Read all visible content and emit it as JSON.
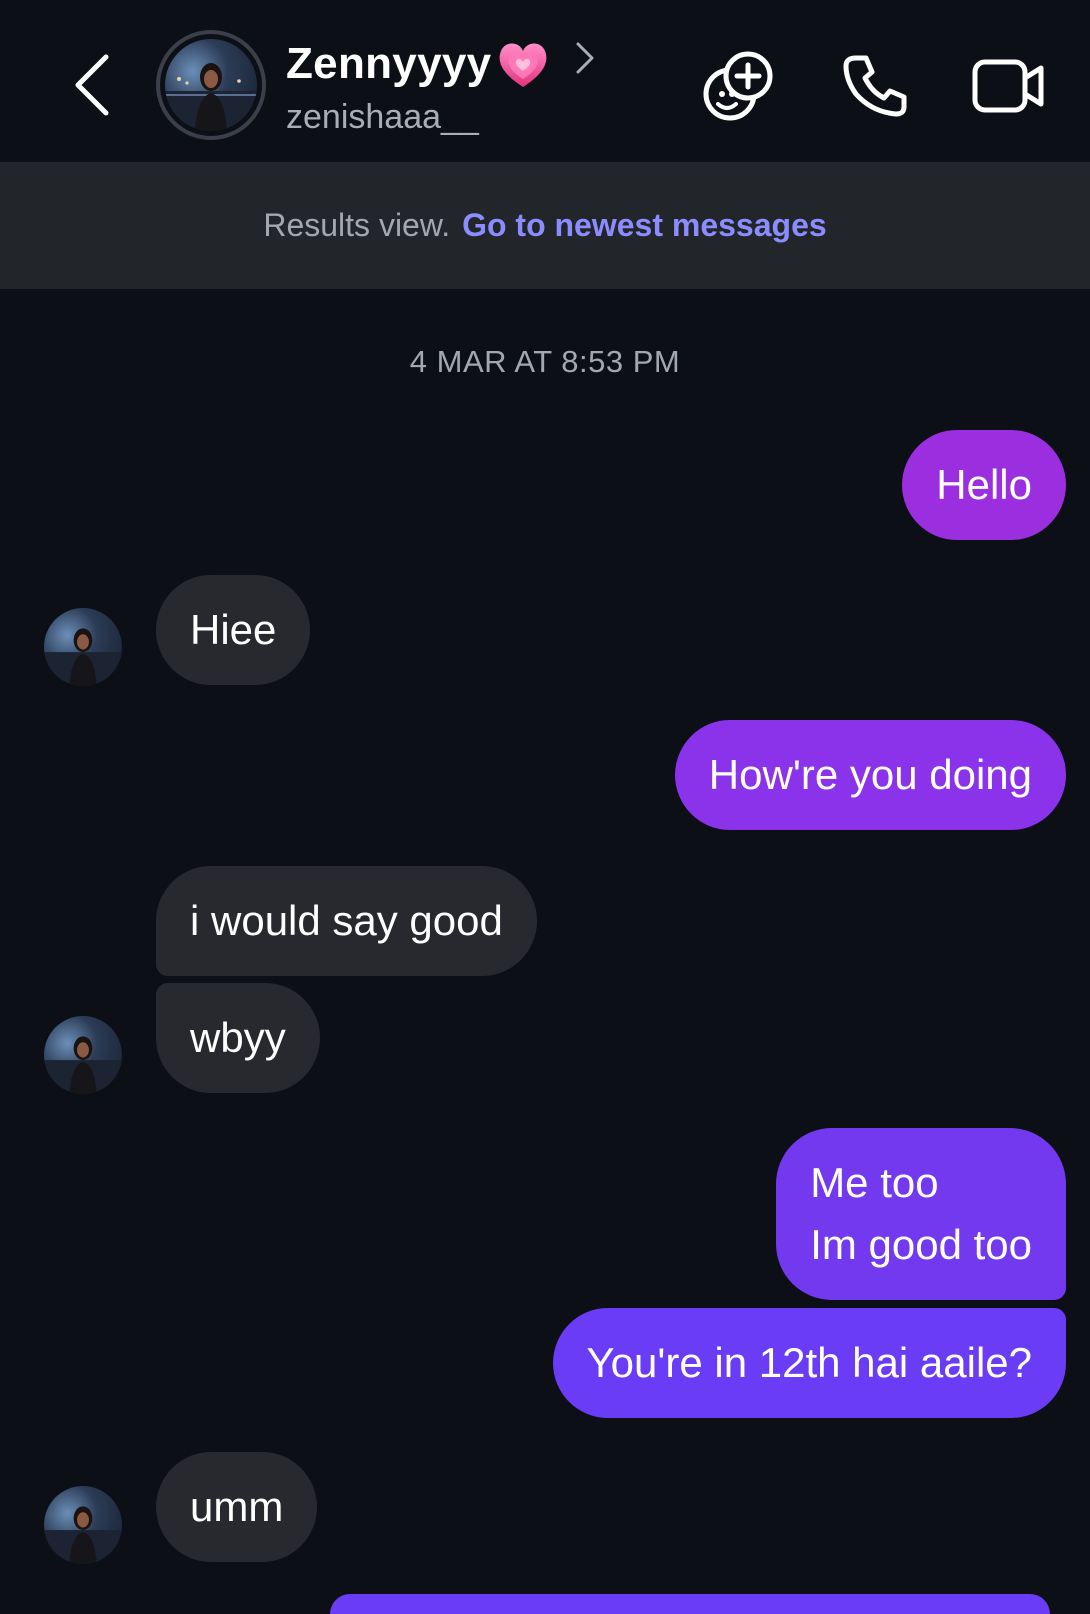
{
  "header": {
    "contact_name": "Zennyyyy",
    "contact_username": "zenishaaa__",
    "icons": {
      "back": "chevron-left-icon",
      "heart": "growing-heart-emoji",
      "open_profile": "chevron-right-icon",
      "stickers": "add-sticker-icon",
      "call": "phone-icon",
      "video": "video-camera-icon"
    }
  },
  "banner": {
    "label": "Results view.",
    "link": "Go to newest messages"
  },
  "thread": {
    "timestamp": "4 MAR AT 8:53 PM",
    "messages": [
      {
        "from": "me",
        "text": "Hello"
      },
      {
        "from": "them",
        "text": "Hiee"
      },
      {
        "from": "me",
        "text": "How're you doing"
      },
      {
        "from": "them",
        "text": "i would say good"
      },
      {
        "from": "them",
        "text": "wbyy"
      },
      {
        "from": "me",
        "text": "Me too\nIm good too"
      },
      {
        "from": "me",
        "text": "You're in 12th hai aaile?"
      },
      {
        "from": "them",
        "text": "umm"
      }
    ]
  },
  "colors": {
    "background": "#0c0f16",
    "banner_bg": "#22252a",
    "incoming_bubble": "#27292f",
    "outgoing_purple_top": "#9b2fe0",
    "outgoing_purple_bottom": "#6a3cf6",
    "link_accent": "#8c8cff"
  }
}
